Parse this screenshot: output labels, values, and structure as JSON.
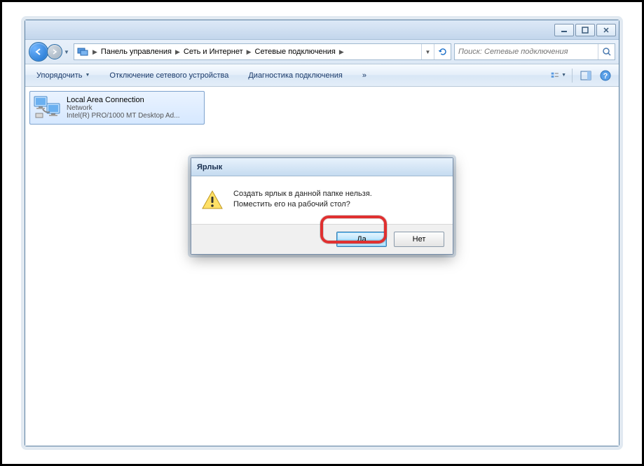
{
  "breadcrumbs": [
    "Панель управления",
    "Сеть и Интернет",
    "Сетевые подключения"
  ],
  "search": {
    "placeholder": "Поиск: Сетевые подключения"
  },
  "toolbar": {
    "organize": "Упорядочить",
    "disable": "Отключение сетевого устройства",
    "diagnose": "Диагностика подключения"
  },
  "connection": {
    "name": "Local Area Connection",
    "status": "Network",
    "adapter": "Intel(R) PRO/1000 MT Desktop Ad..."
  },
  "dialog": {
    "title": "Ярлык",
    "line1": "Создать ярлык в данной папке нельзя.",
    "line2": "Поместить его на рабочий стол?",
    "yes": "Да",
    "no": "Нет"
  }
}
